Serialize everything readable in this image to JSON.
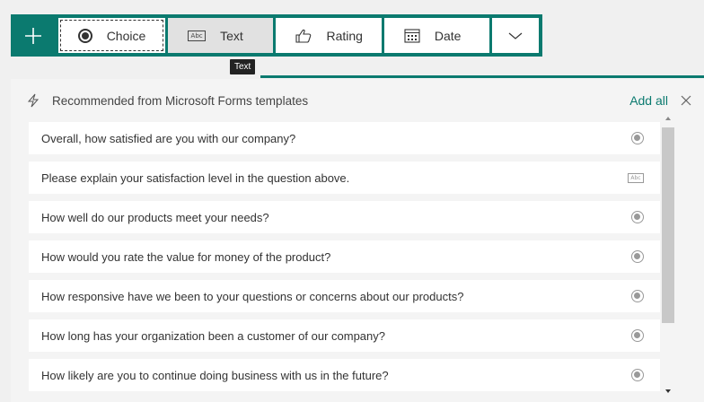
{
  "toolbar": {
    "add_icon": "plus-icon",
    "choice_label": "Choice",
    "text_label": "Text",
    "rating_label": "Rating",
    "date_label": "Date",
    "more_icon": "chevron-down-icon",
    "accent_color": "#0b7a6f"
  },
  "tooltip": {
    "text": "Text"
  },
  "panel": {
    "title": "Recommended from Microsoft Forms templates",
    "add_all_label": "Add all",
    "close_icon": "close-icon"
  },
  "questions": [
    {
      "text": "Overall, how satisfied are you with our company?",
      "type": "choice"
    },
    {
      "text": "Please explain your satisfaction level in the question above.",
      "type": "text"
    },
    {
      "text": "How well do our products meet your needs?",
      "type": "choice"
    },
    {
      "text": "How would you rate the value for money of the product?",
      "type": "choice"
    },
    {
      "text": "How responsive have we been to your questions or concerns about our products?",
      "type": "choice"
    },
    {
      "text": "How long has your organization been a customer of our company?",
      "type": "choice"
    },
    {
      "text": "How likely are you to continue doing business with us in the future?",
      "type": "choice"
    }
  ]
}
